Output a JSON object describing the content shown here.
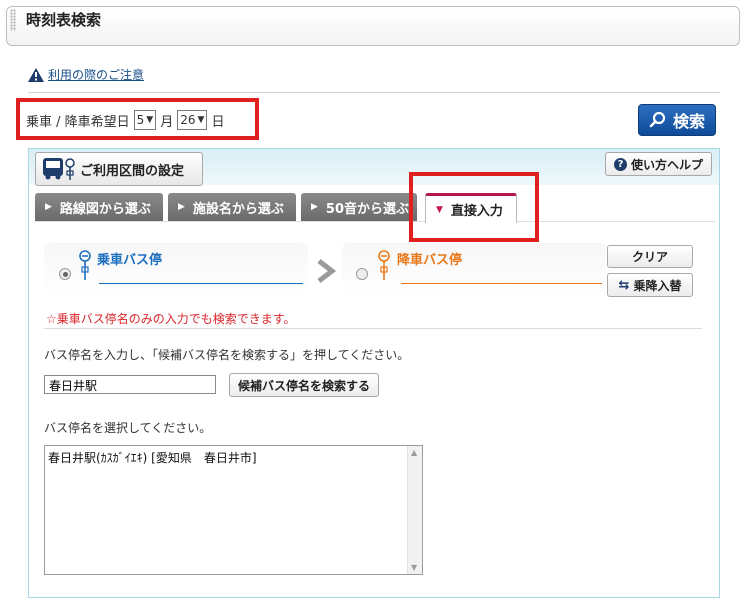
{
  "header": {
    "title": "時刻表検索"
  },
  "notice": {
    "text": "利用の際のご注意"
  },
  "date": {
    "label": "乗車 / 降車希望日",
    "month_value": "5",
    "month_unit": "月",
    "day_value": "26",
    "day_unit": "日"
  },
  "search_button": {
    "label": "検索"
  },
  "section": {
    "title": "ご利用区間の設定",
    "help_label": "使い方ヘルプ"
  },
  "tabs": [
    {
      "label": "路線図から選ぶ"
    },
    {
      "label": "施設名から選ぶ"
    },
    {
      "label": "50音から選ぶ"
    },
    {
      "label": "直接入力"
    }
  ],
  "stops": {
    "boarding_label": "乗車バス停",
    "alighting_label": "降車バス停",
    "clear_label": "クリア",
    "swap_label": "乗降入替"
  },
  "note": "☆乗車バス停名のみの入力でも検索できます。",
  "instruction_input": "バス停名を入力し、「候補バス停名を検索する」を押してください。",
  "input_value": "春日井駅",
  "candidate_button": "候補バス停名を検索する",
  "instruction_select": "バス停名を選択してください。",
  "list_items": [
    "春日井駅(ｶｽｶﾞｲｴｷ) [愛知県　春日井市]"
  ],
  "colors": {
    "accent_red": "#e02020",
    "boarding_blue": "#1f6fbf",
    "alighting_orange": "#e8781a",
    "tab_active_border": "#b4194b"
  }
}
